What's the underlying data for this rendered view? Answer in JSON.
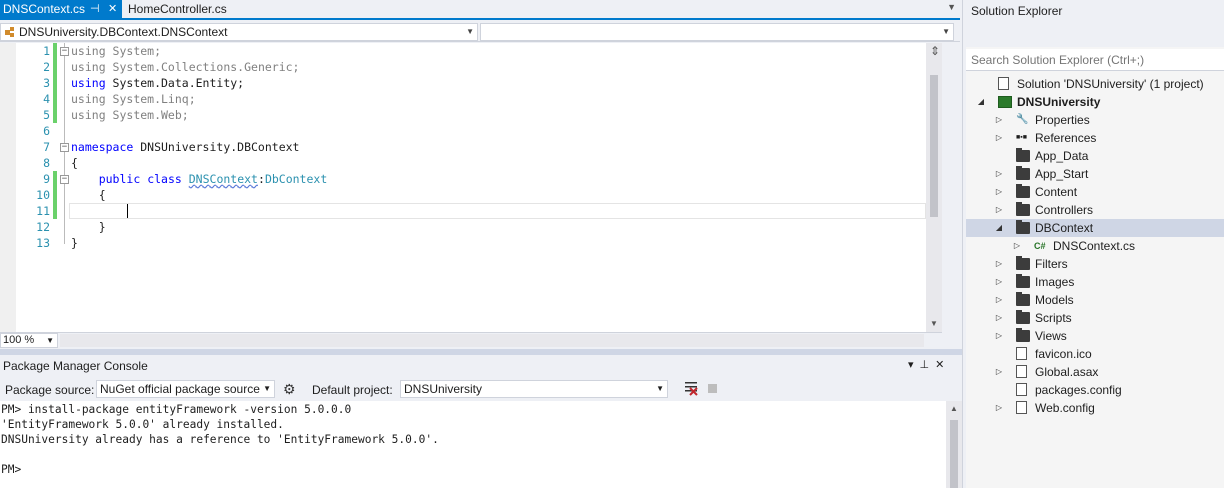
{
  "editor_tabs": [
    {
      "label": "DNSContext.cs",
      "active": true,
      "pin_icon": "pin-icon",
      "close_icon": "close-icon"
    },
    {
      "label": "HomeController.cs",
      "active": false
    }
  ],
  "navbar": {
    "type_selector": "DNSUniversity.DBContext.DNSContext",
    "member_selector": ""
  },
  "code": {
    "lines": [
      {
        "n": "1",
        "parts": [
          {
            "t": "using",
            "c": "gray"
          },
          {
            "t": " System;",
            "c": "gray"
          }
        ]
      },
      {
        "n": "2",
        "parts": [
          {
            "t": "using",
            "c": "gray"
          },
          {
            "t": " System.Collections.Generic;",
            "c": "gray"
          }
        ]
      },
      {
        "n": "3",
        "parts": [
          {
            "t": "using",
            "c": "kw"
          },
          {
            "t": " System.Data.Entity;",
            "c": ""
          }
        ]
      },
      {
        "n": "4",
        "parts": [
          {
            "t": "using",
            "c": "gray"
          },
          {
            "t": " System.Linq;",
            "c": "gray"
          }
        ]
      },
      {
        "n": "5",
        "parts": [
          {
            "t": "using",
            "c": "gray"
          },
          {
            "t": " System.Web;",
            "c": "gray"
          }
        ]
      },
      {
        "n": "6",
        "parts": []
      },
      {
        "n": "7",
        "parts": [
          {
            "t": "namespace",
            "c": "kw"
          },
          {
            "t": " DNSUniversity.DBContext",
            "c": ""
          }
        ]
      },
      {
        "n": "8",
        "parts": [
          {
            "t": "{",
            "c": ""
          }
        ]
      },
      {
        "n": "9",
        "parts": [
          {
            "t": "    ",
            "c": ""
          },
          {
            "t": "public",
            "c": "kw"
          },
          {
            "t": " ",
            "c": ""
          },
          {
            "t": "class",
            "c": "kw"
          },
          {
            "t": " ",
            "c": ""
          },
          {
            "t": "DNSContext",
            "c": "type squig"
          },
          {
            "t": ":",
            "c": ""
          },
          {
            "t": "DbContext",
            "c": "type"
          }
        ]
      },
      {
        "n": "10",
        "parts": [
          {
            "t": "    {",
            "c": ""
          }
        ]
      },
      {
        "n": "11",
        "parts": []
      },
      {
        "n": "12",
        "parts": [
          {
            "t": "    }",
            "c": ""
          }
        ]
      },
      {
        "n": "13",
        "parts": [
          {
            "t": "}",
            "c": ""
          }
        ]
      }
    ]
  },
  "zoom": "100 %",
  "package_manager": {
    "title": "Package Manager Console",
    "source_label": "Package source:",
    "source_value": "NuGet official package source",
    "project_label": "Default project:",
    "project_value": "DNSUniversity",
    "output": [
      "PM> install-package entityFramework -version 5.0.0.0",
      "'EntityFramework 5.0.0' already installed.",
      "DNSUniversity already has a reference to 'EntityFramework 5.0.0'.",
      "",
      "PM>"
    ]
  },
  "solution_explorer": {
    "title": "Solution Explorer",
    "search_placeholder": "Search Solution Explorer (Ctrl+;)",
    "items": [
      {
        "label": "Solution 'DNSUniversity' (1 project)",
        "level": 0,
        "arrow": "",
        "icon": "solution-icon",
        "bold": false
      },
      {
        "label": "DNSUniversity",
        "level": 0,
        "arrow": "expanded",
        "icon": "web-project-icon",
        "bold": true
      },
      {
        "label": "Properties",
        "level": 1,
        "arrow": "collapsed",
        "icon": "wrench-icon",
        "bold": false
      },
      {
        "label": "References",
        "level": 1,
        "arrow": "collapsed",
        "icon": "references-icon",
        "bold": false
      },
      {
        "label": "App_Data",
        "level": 1,
        "arrow": "",
        "icon": "folder-icon",
        "bold": false
      },
      {
        "label": "App_Start",
        "level": 1,
        "arrow": "collapsed",
        "icon": "folder-icon",
        "bold": false
      },
      {
        "label": "Content",
        "level": 1,
        "arrow": "collapsed",
        "icon": "folder-icon",
        "bold": false
      },
      {
        "label": "Controllers",
        "level": 1,
        "arrow": "collapsed",
        "icon": "folder-icon",
        "bold": false
      },
      {
        "label": "DBContext",
        "level": 1,
        "arrow": "expanded",
        "icon": "folder-open-icon",
        "bold": false,
        "selected": true
      },
      {
        "label": "DNSContext.cs",
        "level": 2,
        "arrow": "collapsed",
        "icon": "csharp-file-icon",
        "bold": false
      },
      {
        "label": "Filters",
        "level": 1,
        "arrow": "collapsed",
        "icon": "folder-icon",
        "bold": false
      },
      {
        "label": "Images",
        "level": 1,
        "arrow": "collapsed",
        "icon": "folder-icon",
        "bold": false
      },
      {
        "label": "Models",
        "level": 1,
        "arrow": "collapsed",
        "icon": "folder-icon",
        "bold": false
      },
      {
        "label": "Scripts",
        "level": 1,
        "arrow": "collapsed",
        "icon": "folder-icon",
        "bold": false
      },
      {
        "label": "Views",
        "level": 1,
        "arrow": "collapsed",
        "icon": "folder-icon",
        "bold": false
      },
      {
        "label": "favicon.ico",
        "level": 1,
        "arrow": "",
        "icon": "image-file-icon",
        "bold": false
      },
      {
        "label": "Global.asax",
        "level": 1,
        "arrow": "collapsed",
        "icon": "gear-file-icon",
        "bold": false
      },
      {
        "label": "packages.config",
        "level": 1,
        "arrow": "",
        "icon": "config-file-icon",
        "bold": false
      },
      {
        "label": "Web.config",
        "level": 1,
        "arrow": "collapsed",
        "icon": "config-file-icon",
        "bold": false
      }
    ]
  },
  "colors": {
    "accent": "#007acc",
    "selected_row": "#cfd6e5",
    "keyword": "#0000ff",
    "type": "#2b91af",
    "line_number": "#2b91af",
    "change_bar": "#6bd16b"
  }
}
